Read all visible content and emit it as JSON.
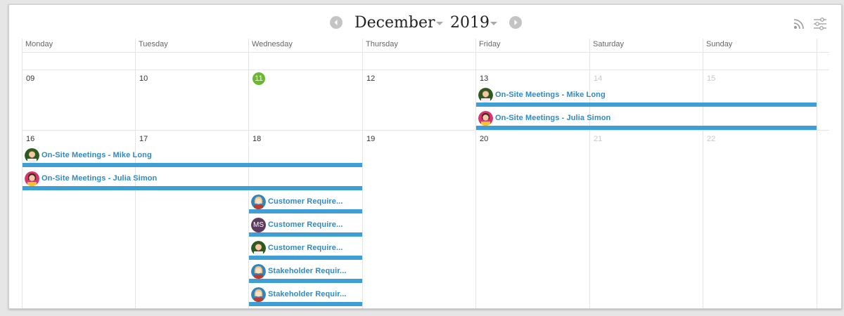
{
  "header": {
    "month": "December",
    "year": "2019",
    "prev_icon": "chevron-left-icon",
    "next_icon": "chevron-right-icon",
    "rss_icon": "rss-feed-icon",
    "settings_icon": "sliders-icon"
  },
  "weekdays": [
    "Monday",
    "Tuesday",
    "Wednesday",
    "Thursday",
    "Friday",
    "Saturday",
    "Sunday"
  ],
  "weeks": [
    {
      "dates": [
        "09",
        "10",
        "11",
        "12",
        "13",
        "14",
        "15"
      ],
      "muted": [
        false,
        false,
        false,
        false,
        false,
        true,
        true
      ],
      "today_index": 2
    },
    {
      "dates": [
        "16",
        "17",
        "18",
        "19",
        "20",
        "21",
        "22"
      ],
      "muted": [
        false,
        false,
        false,
        false,
        false,
        true,
        true
      ],
      "today_index": -1
    }
  ],
  "events": [
    {
      "title": "On-Site Meetings - Mike Long",
      "avatar": "mike-long",
      "initials": ""
    },
    {
      "title": "On-Site Meetings - Julia Simon",
      "avatar": "julia-simon",
      "initials": ""
    },
    {
      "title": "On-Site Meetings - Mike Long",
      "avatar": "mike-long",
      "initials": ""
    },
    {
      "title": "On-Site Meetings - Julia Simon",
      "avatar": "julia-simon",
      "initials": ""
    },
    {
      "title": "Customer Require...",
      "avatar": "blonde-woman",
      "initials": ""
    },
    {
      "title": "Customer Require...",
      "avatar": "initials",
      "initials": "MS"
    },
    {
      "title": "Customer Require...",
      "avatar": "mike-long",
      "initials": ""
    },
    {
      "title": "Stakeholder Requir...",
      "avatar": "blonde-woman",
      "initials": ""
    },
    {
      "title": "Stakeholder Requir...",
      "avatar": "blonde-woman",
      "initials": ""
    }
  ],
  "colors": {
    "event_bar": "#3f9ed4",
    "event_text": "#2f8ac5",
    "today": "#6ab82f"
  }
}
